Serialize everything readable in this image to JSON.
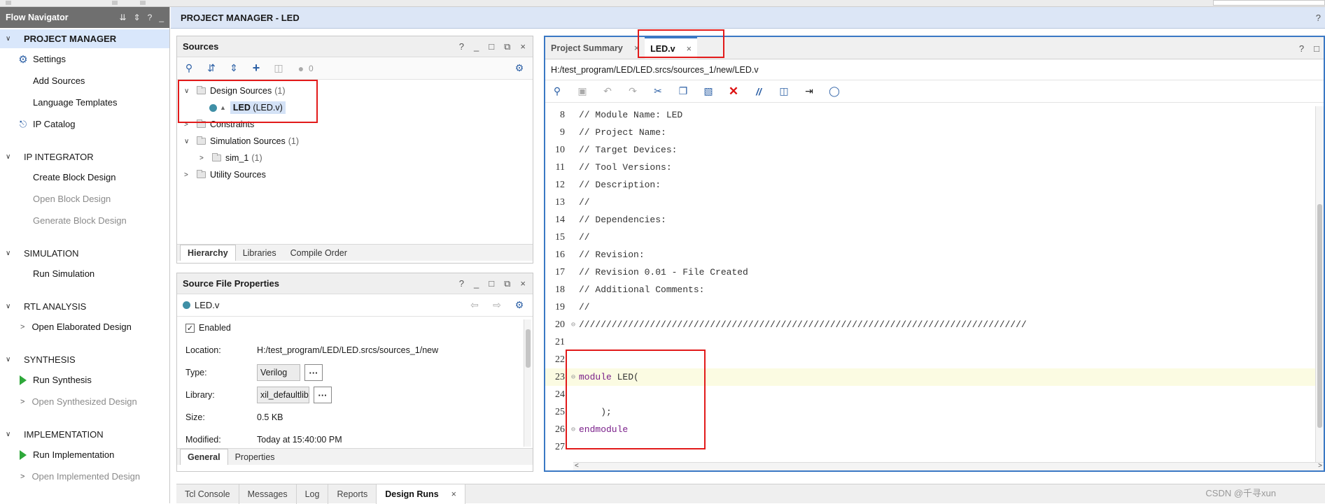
{
  "flow_navigator": {
    "title": "Flow Navigator",
    "header_icons": [
      "⇊",
      "⇕",
      "?",
      "_"
    ],
    "sections": [
      {
        "label": "PROJECT MANAGER",
        "items": [
          {
            "label": "Settings",
            "icon": "gear-icon"
          },
          {
            "label": "Add Sources"
          },
          {
            "label": "Language Templates"
          },
          {
            "label": "IP Catalog",
            "icon": "ip-catalog-icon"
          }
        ]
      },
      {
        "label": "IP INTEGRATOR",
        "items": [
          {
            "label": "Create Block Design"
          },
          {
            "label": "Open Block Design",
            "disabled": true
          },
          {
            "label": "Generate Block Design",
            "disabled": true
          }
        ]
      },
      {
        "label": "SIMULATION",
        "items": [
          {
            "label": "Run Simulation"
          }
        ]
      },
      {
        "label": "RTL ANALYSIS",
        "items": [
          {
            "label": "Open Elaborated Design",
            "expand": true
          }
        ]
      },
      {
        "label": "SYNTHESIS",
        "items": [
          {
            "label": "Run Synthesis",
            "icon": "play-icon"
          },
          {
            "label": "Open Synthesized Design",
            "expand": true,
            "disabled": true
          }
        ]
      },
      {
        "label": "IMPLEMENTATION",
        "items": [
          {
            "label": "Run Implementation",
            "icon": "play-icon"
          },
          {
            "label": "Open Implemented Design",
            "expand": true,
            "disabled": true
          }
        ]
      }
    ]
  },
  "header": {
    "title": "PROJECT MANAGER - LED",
    "help": "?"
  },
  "sources_panel": {
    "title": "Sources",
    "window_icons": [
      "?",
      "_",
      "□",
      "⧉",
      "×"
    ],
    "error_count": "0",
    "tree": {
      "design_sources": {
        "label": "Design Sources",
        "count": "(1)"
      },
      "led_file": {
        "label": "LED",
        "file": "(LED.v)"
      },
      "constraints": {
        "label": "Constraints"
      },
      "simulation_sources": {
        "label": "Simulation Sources",
        "count": "(1)"
      },
      "sim_1": {
        "label": "sim_1",
        "count": "(1)"
      },
      "utility_sources": {
        "label": "Utility Sources"
      }
    },
    "tabs": [
      "Hierarchy",
      "Libraries",
      "Compile Order"
    ]
  },
  "properties_panel": {
    "title": "Source File Properties",
    "file_name": "LED.v",
    "enabled_label": "Enabled",
    "rows": {
      "location": {
        "key": "Location:",
        "value": "H:/test_program/LED/LED.srcs/sources_1/new"
      },
      "type": {
        "key": "Type:",
        "value": "Verilog"
      },
      "library": {
        "key": "Library:",
        "value": "xil_defaultlib"
      },
      "size": {
        "key": "Size:",
        "value": "0.5 KB"
      },
      "modified": {
        "key": "Modified:",
        "value": "Today at 15:40:00 PM"
      }
    },
    "ellipsis": "···",
    "tabs": [
      "General",
      "Properties"
    ]
  },
  "editor": {
    "tabs": [
      {
        "label": "Project Summary",
        "close": "×"
      },
      {
        "label": "LED.v",
        "close": "×"
      }
    ],
    "path": "H:/test_program/LED/LED.srcs/sources_1/new/LED.v",
    "window_icons": [
      "?",
      "□"
    ],
    "lines": [
      {
        "n": "8",
        "text": "// Module Name: LED"
      },
      {
        "n": "9",
        "text": "// Project Name:"
      },
      {
        "n": "10",
        "text": "// Target Devices:"
      },
      {
        "n": "11",
        "text": "// Tool Versions:"
      },
      {
        "n": "12",
        "text": "// Description:"
      },
      {
        "n": "13",
        "text": "//"
      },
      {
        "n": "14",
        "text": "// Dependencies:"
      },
      {
        "n": "15",
        "text": "//"
      },
      {
        "n": "16",
        "text": "// Revision:"
      },
      {
        "n": "17",
        "text": "// Revision 0.01 - File Created"
      },
      {
        "n": "18",
        "text": "// Additional Comments:"
      },
      {
        "n": "19",
        "text": "//"
      },
      {
        "n": "20",
        "text": "//////////////////////////////////////////////////////////////////////////////////"
      },
      {
        "n": "21",
        "text": ""
      },
      {
        "n": "22",
        "text": ""
      },
      {
        "n": "23",
        "kw": "module",
        "text": " LED("
      },
      {
        "n": "24",
        "text": ""
      },
      {
        "n": "25",
        "text": "    );"
      },
      {
        "n": "26",
        "kw": "endmodule",
        "text": ""
      },
      {
        "n": "27",
        "text": ""
      }
    ]
  },
  "bottom_tabs": [
    {
      "label": "Tcl Console"
    },
    {
      "label": "Messages"
    },
    {
      "label": "Log"
    },
    {
      "label": "Reports"
    },
    {
      "label": "Design Runs",
      "close": "×"
    }
  ],
  "watermark": "CSDN @千寻xun",
  "colors": {
    "accent": "#3a78c4",
    "highlight_box": "#e21a1a",
    "keyword": "#7a1f8a",
    "play": "#2ea83a"
  }
}
